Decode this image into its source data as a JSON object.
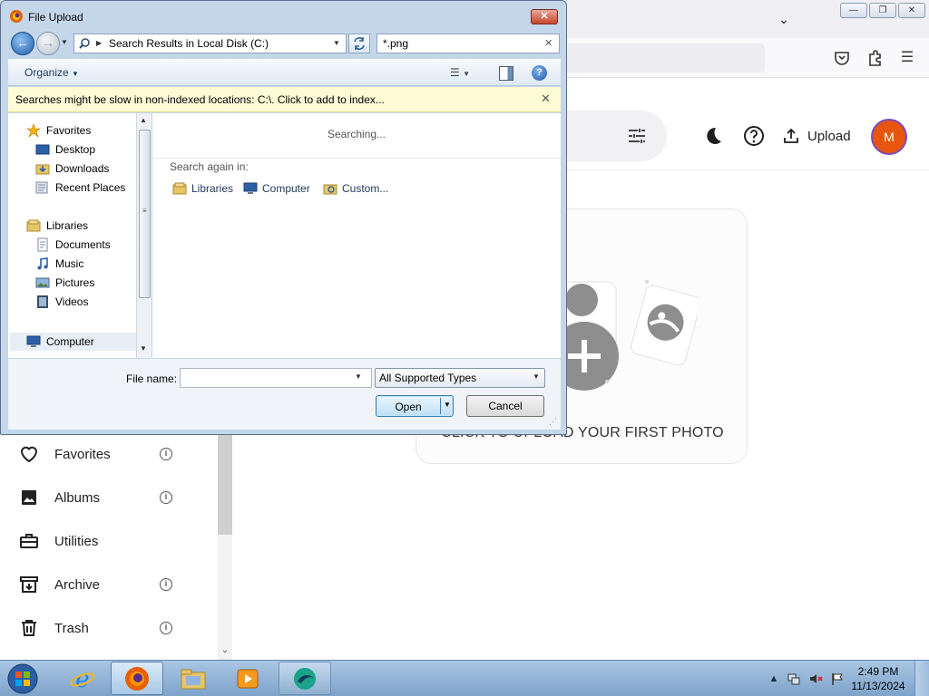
{
  "dialog": {
    "title": "File Upload",
    "address": "Search Results in Local Disk (C:)",
    "search_value": "*.png",
    "toolbar": {
      "organize_label": "Organize"
    },
    "infobar_text": "Searches might be slow in non-indexed locations: C:\\. Click to add to index...",
    "nav": {
      "favorites": "Favorites",
      "desktop": "Desktop",
      "downloads": "Downloads",
      "recent_places": "Recent Places",
      "libraries": "Libraries",
      "documents": "Documents",
      "music": "Music",
      "pictures": "Pictures",
      "videos": "Videos",
      "computer": "Computer"
    },
    "results": {
      "status": "Searching...",
      "search_again_label": "Search again in:",
      "search_again_items": [
        "Libraries",
        "Computer",
        "Custom..."
      ]
    },
    "bottom": {
      "filename_label": "File name:",
      "filename_value": "",
      "filetype_value": "All Supported Types",
      "open_label": "Open",
      "cancel_label": "Cancel"
    }
  },
  "app": {
    "upload_label": "Upload",
    "avatar_initial": "M",
    "sidebar": [
      {
        "label": "Favorites",
        "icon": "heart-icon",
        "info": true
      },
      {
        "label": "Albums",
        "icon": "album-icon",
        "info": true
      },
      {
        "label": "Utilities",
        "icon": "toolbox-icon",
        "info": false
      },
      {
        "label": "Archive",
        "icon": "archive-icon",
        "info": true
      },
      {
        "label": "Trash",
        "icon": "trash-icon",
        "info": true
      }
    ],
    "upload_prompt": "CLICK TO UPLOAD YOUR FIRST PHOTO",
    "avatar_color": "#e8550e"
  },
  "taskbar": {
    "apps": [
      "start-button",
      "internet-explorer",
      "firefox",
      "windows-explorer",
      "media-player",
      "photo-app"
    ],
    "clock_time": "2:49 PM",
    "clock_date": "11/13/2024"
  }
}
